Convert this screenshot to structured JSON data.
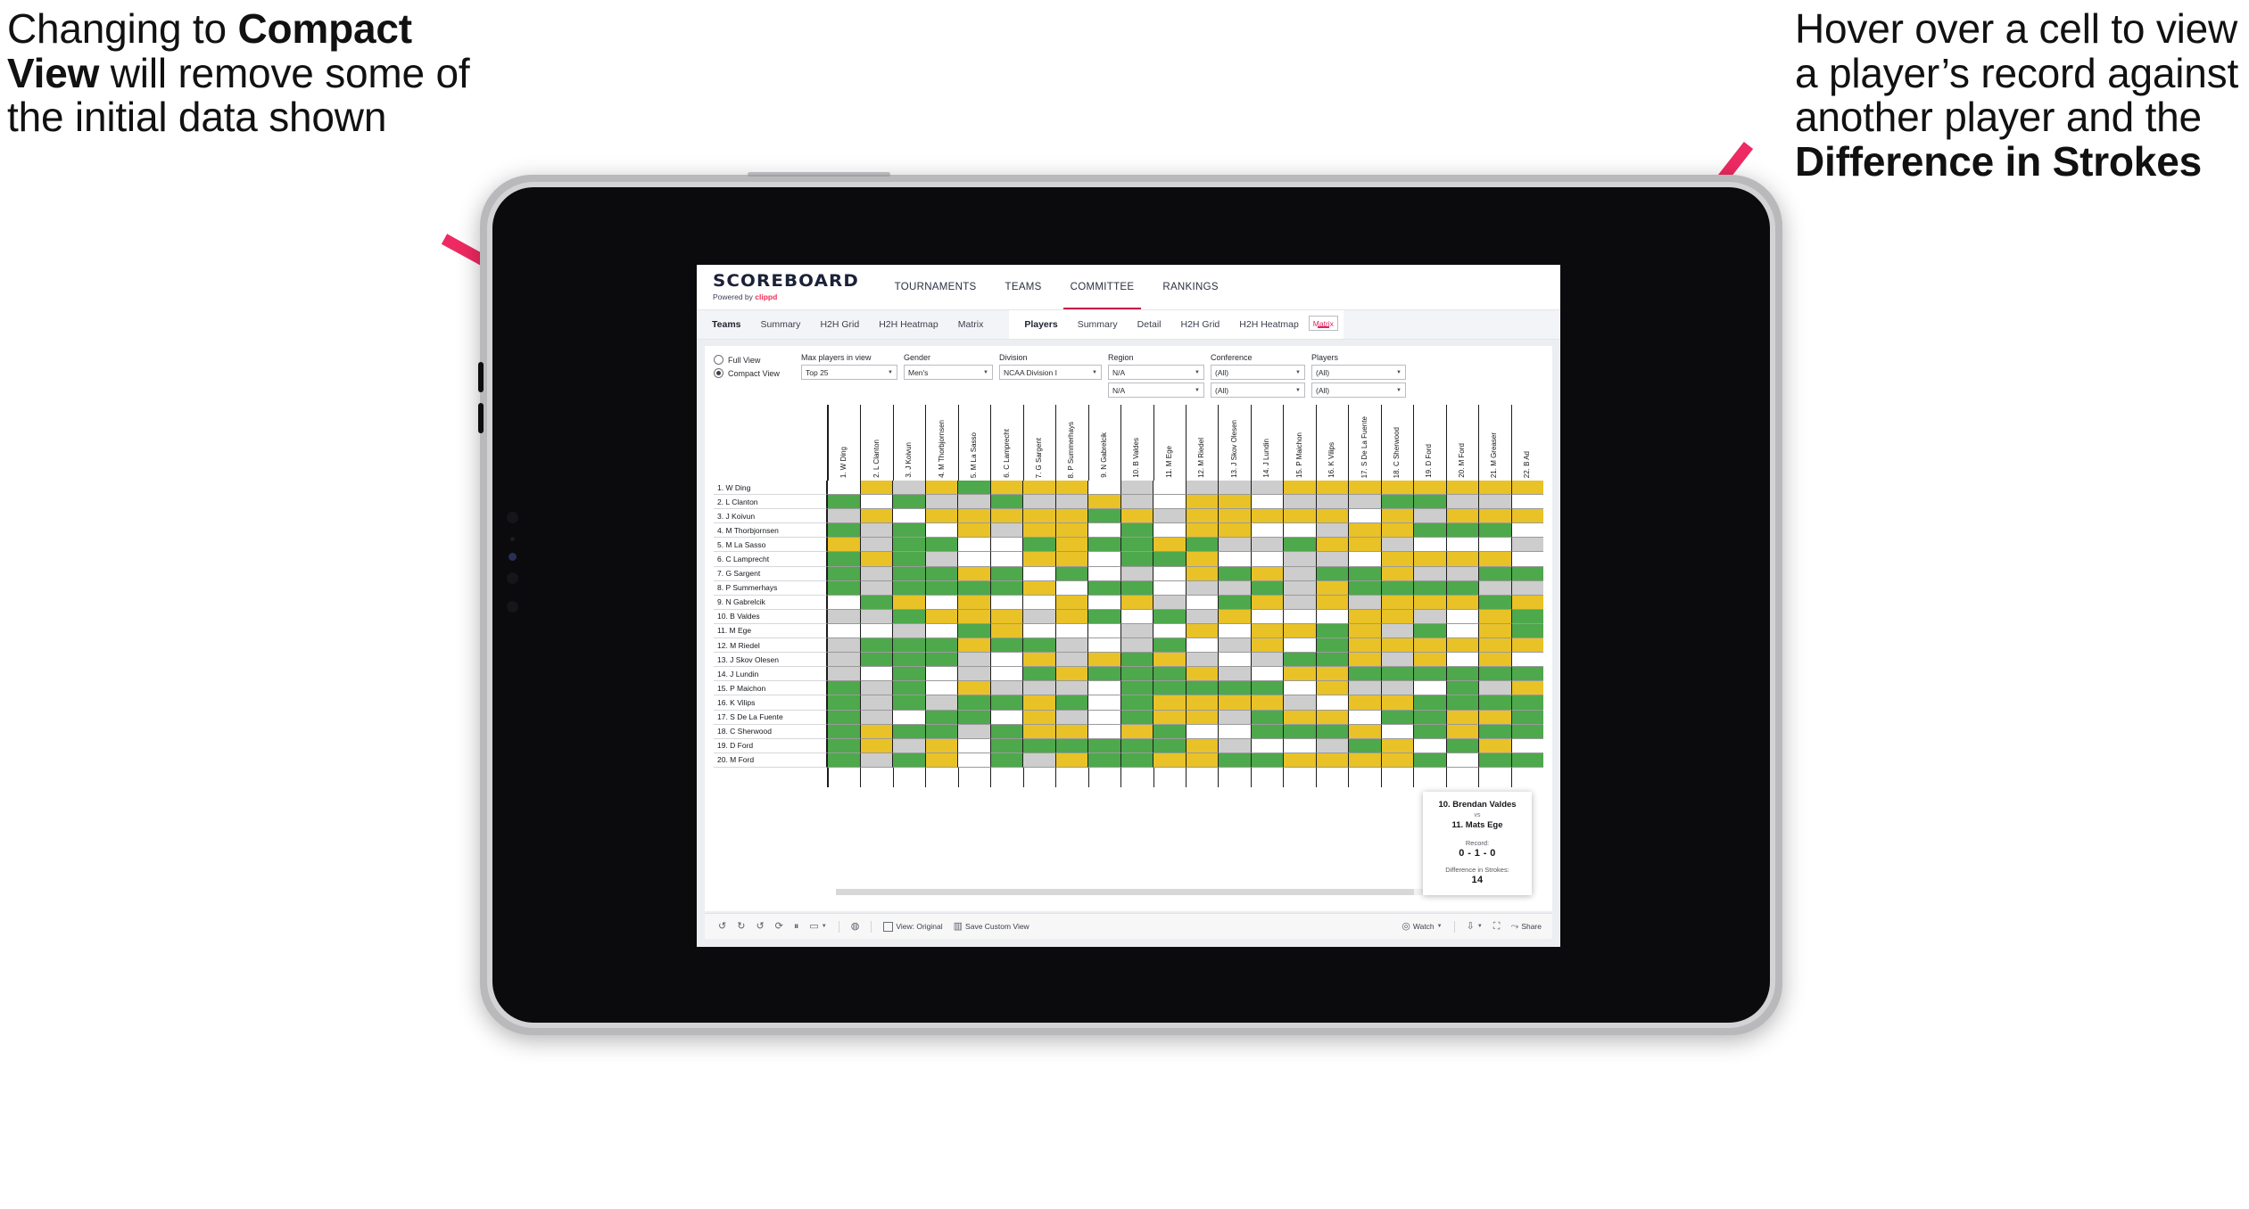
{
  "annotations": {
    "left": {
      "pre": "Changing to ",
      "bold": "Compact View",
      "post": " will remove some of the initial data shown"
    },
    "right": {
      "pre": "Hover over a cell to view a player’s record against another player and the ",
      "bold": "Difference in Strokes",
      "post": ""
    },
    "arrow_color": "#EE2A62"
  },
  "app": {
    "logo": {
      "title": "SCOREBOARD",
      "sub_pre": "Powered by ",
      "sub_brand": "clippd"
    },
    "nav_tabs": [
      {
        "label": "TOURNAMENTS",
        "active": false
      },
      {
        "label": "TEAMS",
        "active": false
      },
      {
        "label": "COMMITTEE",
        "active": true
      },
      {
        "label": "RANKINGS",
        "active": false
      }
    ],
    "sub_tabs_teams": [
      {
        "label": "Teams",
        "style": "head"
      },
      {
        "label": "Summary",
        "style": ""
      },
      {
        "label": "H2H Grid",
        "style": ""
      },
      {
        "label": "H2H Heatmap",
        "style": ""
      },
      {
        "label": "Matrix",
        "style": ""
      }
    ],
    "sub_tabs_players": [
      {
        "label": "Players",
        "style": "head"
      },
      {
        "label": "Summary",
        "style": ""
      },
      {
        "label": "Detail",
        "style": ""
      },
      {
        "label": "H2H Grid",
        "style": ""
      },
      {
        "label": "H2H Heatmap",
        "style": ""
      },
      {
        "label": "Matrix",
        "style": "sel"
      }
    ],
    "accent_color": "#E0245E"
  },
  "filters": {
    "view_options": [
      {
        "label": "Full View",
        "selected": false
      },
      {
        "label": "Compact View",
        "selected": true
      }
    ],
    "dropdowns": [
      {
        "label": "Max players in view",
        "value": "Top 25",
        "width": "w-max"
      },
      {
        "label": "Gender",
        "value": "Men's",
        "width": "w-gen"
      },
      {
        "label": "Division",
        "value": "NCAA Division I",
        "width": "w-div"
      }
    ],
    "stacked": [
      {
        "label": "Region",
        "values": [
          "N/A",
          "N/A"
        ],
        "width": "w-reg"
      },
      {
        "label": "Conference",
        "values": [
          "(All)",
          "(All)"
        ],
        "width": "w-con"
      },
      {
        "label": "Players",
        "values": [
          "(All)",
          "(All)"
        ],
        "width": "w-ply"
      }
    ]
  },
  "matrix": {
    "columns": [
      "1. W Ding",
      "2. L Clanton",
      "3. J Koivun",
      "4. M Thorbjornsen",
      "5. M La Sasso",
      "6. C Lamprecht",
      "7. G Sargent",
      "8. P Summerhays",
      "9. N Gabrelcik",
      "10. B Valdes",
      "11. M Ege",
      "12. M Riedel",
      "13. J Skov Olesen",
      "14. J Lundin",
      "15. P Maichon",
      "16. K Vilips",
      "17. S De La Fuente",
      "18. C Sherwood",
      "19. D Ford",
      "20. M Ford",
      "21. M Greaser",
      "22. B Ad"
    ],
    "rows": [
      "1. W Ding",
      "2. L Clanton",
      "3. J Koivun",
      "4. M Thorbjornsen",
      "5. M La Sasso",
      "6. C Lamprecht",
      "7. G Sargent",
      "8. P Summerhays",
      "9. N Gabrelcik",
      "10. B Valdes",
      "11. M Ege",
      "12. M Riedel",
      "13. J Skov Olesen",
      "14. J Lundin",
      "15. P Maichon",
      "16. K Vilips",
      "17. S De La Fuente",
      "18. C Sherwood",
      "19. D Ford",
      "20. M Ford"
    ],
    "legend_colors": {
      "win": "#4EA84C",
      "tie": "#E9C227",
      "loss": "#CDCDCD",
      "none": "#FFFFFF"
    },
    "cells": [
      [
        "w",
        "y",
        "a",
        "y",
        "g",
        "y",
        "y",
        "y",
        "w",
        "a",
        "w",
        "a",
        "a",
        "a",
        "y",
        "y",
        "y",
        "y",
        "y",
        "y",
        "y",
        "y"
      ],
      [
        "g",
        "w",
        "g",
        "a",
        "a",
        "g",
        "a",
        "a",
        "y",
        "a",
        "w",
        "y",
        "y",
        "w",
        "a",
        "a",
        "a",
        "g",
        "g",
        "a",
        "a",
        "w"
      ],
      [
        "a",
        "y",
        "w",
        "y",
        "y",
        "y",
        "y",
        "y",
        "g",
        "y",
        "a",
        "y",
        "y",
        "y",
        "y",
        "y",
        "w",
        "y",
        "a",
        "y",
        "y",
        "y"
      ],
      [
        "g",
        "a",
        "g",
        "w",
        "y",
        "a",
        "y",
        "y",
        "w",
        "g",
        "w",
        "y",
        "y",
        "w",
        "w",
        "a",
        "y",
        "y",
        "g",
        "g",
        "g",
        "w"
      ],
      [
        "y",
        "a",
        "g",
        "g",
        "w",
        "w",
        "g",
        "y",
        "g",
        "g",
        "y",
        "g",
        "a",
        "a",
        "g",
        "y",
        "y",
        "a",
        "w",
        "w",
        "w",
        "a"
      ],
      [
        "g",
        "y",
        "g",
        "a",
        "w",
        "w",
        "y",
        "y",
        "w",
        "g",
        "g",
        "y",
        "w",
        "w",
        "a",
        "a",
        "w",
        "y",
        "y",
        "y",
        "y",
        "w"
      ],
      [
        "g",
        "a",
        "g",
        "g",
        "y",
        "g",
        "w",
        "g",
        "w",
        "a",
        "w",
        "y",
        "g",
        "y",
        "a",
        "g",
        "g",
        "y",
        "a",
        "a",
        "g",
        "g"
      ],
      [
        "g",
        "a",
        "g",
        "g",
        "g",
        "g",
        "y",
        "w",
        "g",
        "g",
        "w",
        "a",
        "a",
        "g",
        "a",
        "y",
        "g",
        "g",
        "g",
        "g",
        "a",
        "a"
      ],
      [
        "w",
        "g",
        "y",
        "w",
        "y",
        "w",
        "w",
        "y",
        "w",
        "y",
        "a",
        "w",
        "g",
        "y",
        "a",
        "y",
        "a",
        "y",
        "y",
        "y",
        "g",
        "y"
      ],
      [
        "a",
        "a",
        "g",
        "y",
        "y",
        "y",
        "a",
        "y",
        "g",
        "w",
        "g",
        "a",
        "y",
        "w",
        "w",
        "w",
        "y",
        "y",
        "a",
        "w",
        "y",
        "g"
      ],
      [
        "w",
        "w",
        "a",
        "w",
        "g",
        "y",
        "w",
        "w",
        "w",
        "a",
        "w",
        "y",
        "w",
        "y",
        "y",
        "g",
        "y",
        "a",
        "g",
        "w",
        "y",
        "g"
      ],
      [
        "a",
        "g",
        "g",
        "g",
        "y",
        "g",
        "g",
        "a",
        "w",
        "a",
        "g",
        "w",
        "a",
        "y",
        "w",
        "g",
        "y",
        "y",
        "y",
        "y",
        "y",
        "y"
      ],
      [
        "a",
        "g",
        "g",
        "g",
        "a",
        "w",
        "y",
        "a",
        "y",
        "g",
        "y",
        "a",
        "w",
        "a",
        "g",
        "g",
        "y",
        "a",
        "y",
        "w",
        "y",
        "w"
      ],
      [
        "a",
        "w",
        "g",
        "w",
        "a",
        "w",
        "g",
        "y",
        "g",
        "g",
        "g",
        "y",
        "a",
        "w",
        "y",
        "y",
        "g",
        "g",
        "g",
        "g",
        "g",
        "g"
      ],
      [
        "g",
        "a",
        "g",
        "w",
        "y",
        "a",
        "a",
        "a",
        "w",
        "g",
        "g",
        "g",
        "g",
        "g",
        "w",
        "y",
        "a",
        "a",
        "w",
        "g",
        "a",
        "y"
      ],
      [
        "g",
        "a",
        "g",
        "a",
        "g",
        "g",
        "y",
        "g",
        "w",
        "g",
        "y",
        "y",
        "y",
        "y",
        "a",
        "w",
        "y",
        "y",
        "g",
        "g",
        "g",
        "g"
      ],
      [
        "g",
        "a",
        "w",
        "g",
        "g",
        "w",
        "y",
        "a",
        "w",
        "g",
        "y",
        "y",
        "a",
        "g",
        "y",
        "y",
        "w",
        "g",
        "g",
        "y",
        "y",
        "g"
      ],
      [
        "g",
        "y",
        "g",
        "g",
        "a",
        "g",
        "y",
        "y",
        "w",
        "y",
        "g",
        "w",
        "w",
        "g",
        "g",
        "g",
        "y",
        "w",
        "g",
        "y",
        "g",
        "g"
      ],
      [
        "g",
        "y",
        "a",
        "y",
        "w",
        "g",
        "g",
        "g",
        "g",
        "g",
        "g",
        "y",
        "a",
        "w",
        "w",
        "a",
        "g",
        "y",
        "w",
        "g",
        "y",
        "w"
      ],
      [
        "g",
        "a",
        "g",
        "y",
        "w",
        "g",
        "a",
        "y",
        "g",
        "g",
        "y",
        "y",
        "g",
        "g",
        "y",
        "y",
        "y",
        "y",
        "g",
        "w",
        "g",
        "g"
      ]
    ]
  },
  "tooltip": {
    "player_a": "10. Brendan Valdes",
    "vs": "vs",
    "player_b": "11. Mats Ege",
    "record_label": "Record:",
    "record_value": "0 - 1 - 0",
    "diff_label": "Difference in Strokes:",
    "diff_value": "14"
  },
  "bottom_bar": {
    "items": [
      {
        "icon": "undo-icon",
        "label": ""
      },
      {
        "icon": "redo-icon",
        "label": ""
      },
      {
        "icon": "revert-icon",
        "label": ""
      },
      {
        "icon": "refresh-data-icon",
        "label": ""
      },
      {
        "icon": "pause-updates-icon",
        "label": ""
      },
      {
        "icon": "highlight-icon",
        "label": "",
        "caret": true
      }
    ],
    "history_icon": "history-icon",
    "view_original": {
      "icon": "view-icon",
      "label": "View: Original"
    },
    "save_custom_view": {
      "icon": "save-view-icon",
      "label": "Save Custom View"
    },
    "watch": {
      "icon": "watch-icon",
      "label": "Watch",
      "caret": true
    },
    "download": {
      "icon": "download-icon",
      "caret": true
    },
    "fullscreen": {
      "icon": "fullscreen-icon"
    },
    "share": {
      "icon": "share-icon",
      "label": "Share"
    }
  }
}
